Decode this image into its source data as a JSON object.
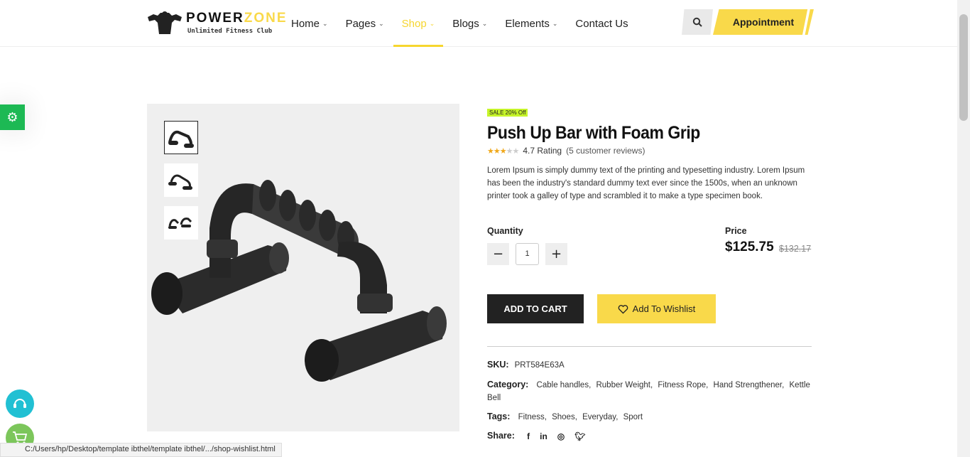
{
  "header": {
    "logo": {
      "title_a": "POWER",
      "title_b": "ZONE",
      "subtitle": "Unlimited Fitness Club"
    },
    "nav": [
      {
        "label": "Home",
        "has_dropdown": true
      },
      {
        "label": "Pages",
        "has_dropdown": true
      },
      {
        "label": "Shop",
        "has_dropdown": true,
        "active": true
      },
      {
        "label": "Blogs",
        "has_dropdown": true
      },
      {
        "label": "Elements",
        "has_dropdown": true
      },
      {
        "label": "Contact Us",
        "has_dropdown": false
      }
    ],
    "search_icon": "search-icon",
    "appointment_label": "Appointment"
  },
  "product": {
    "badge": "SALE 20% Off",
    "title": "Push Up Bar with Foam Grip",
    "rating_stars": 3,
    "rating_max": 5,
    "rating_text": "4.7 Rating",
    "reviews_text": "(5 customer reviews)",
    "description": "Lorem Ipsum is simply dummy text of the printing and typesetting industry. Lorem Ipsum has been the industry's standard dummy text ever since the 1500s, when an unknown printer took a galley of type and scrambled it to make a type specimen book.",
    "quantity_label": "Quantity",
    "quantity_value": "1",
    "price_label": "Price",
    "price_now": "$125.75",
    "price_old": "$132.17",
    "add_to_cart_label": "ADD TO CART",
    "wishlist_label": "Add To Wishlist",
    "sku_label": "SKU:",
    "sku_value": "PRT584E63A",
    "category_label": "Category:",
    "categories": [
      "Cable handles,",
      "Rubber Weight,",
      "Fitness Rope,",
      "Hand Strengthener,",
      "Kettle Bell"
    ],
    "tags_label": "Tags:",
    "tags": [
      "Fitness,",
      "Shoes,",
      "Everyday,",
      "Sport"
    ],
    "share_label": "Share:",
    "share_icons": [
      "facebook-icon",
      "linkedin-icon",
      "instagram-icon",
      "twitter-icon"
    ]
  },
  "status_bar": {
    "url": "C:/Users/hp/Desktop/template ibthel/template ibthel/.../shop-wishlist.html"
  },
  "colors": {
    "accent": "#f9d94a",
    "dark": "#222222",
    "settings": "#1db954",
    "support": "#21c0d3",
    "cart": "#7cc65b"
  }
}
